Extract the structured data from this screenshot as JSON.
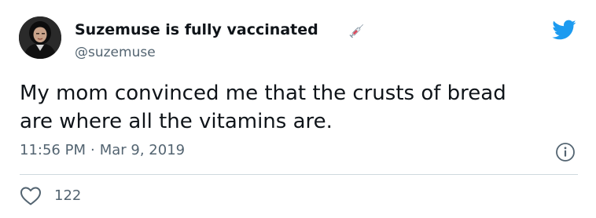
{
  "author": {
    "display_name": "Suzemuse is fully vaccinated",
    "handle": "@suzemuse",
    "avatar_icon": "profile-photo",
    "name_emoji_icon": "syringe-icon"
  },
  "brand": {
    "logo_icon": "twitter-bird-icon",
    "accent_color": "#1d9bf0"
  },
  "tweet": {
    "text_line1": "My mom convinced me that the crusts of bread",
    "text_line2": "are where all the vitamins are.",
    "time": "11:56 PM",
    "separator": "·",
    "date": "Mar 9, 2019"
  },
  "actions": {
    "like_icon": "heart-icon",
    "like_count": "122",
    "info_icon": "info-icon"
  },
  "colors": {
    "text": "#0f1419",
    "secondary_text": "#536471",
    "divider": "#cfd9de"
  }
}
